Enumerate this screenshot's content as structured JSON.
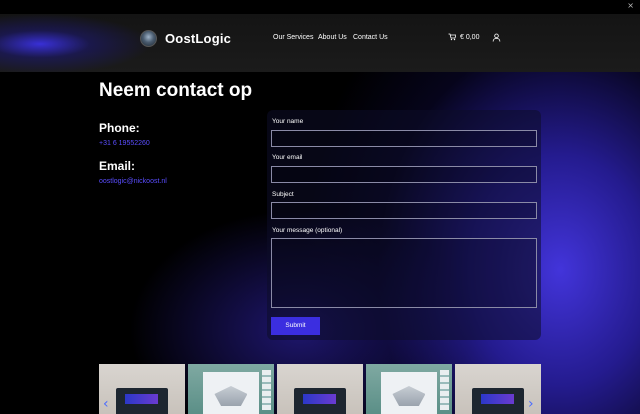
{
  "header": {
    "brand": "OostLogic",
    "nav": [
      "Our Services",
      "About Us",
      "Contact Us"
    ],
    "cart_total": "€ 0,00"
  },
  "main": {
    "title": "Neem contact op",
    "phone_label": "Phone:",
    "phone_value": "+31 6 19552260",
    "email_label": "Email:",
    "email_value": "oostlogic@nickoost.nl"
  },
  "form": {
    "name_label": "Your name",
    "email_label": "Your email",
    "subject_label": "Subject",
    "message_label": "Your message (optional)",
    "submit_label": "Submit"
  },
  "colors": {
    "accent": "#3b2ee0",
    "link": "#5a4dff",
    "background": "#000000"
  },
  "icons": [
    "close-icon",
    "logo-icon",
    "cart-icon",
    "user-icon",
    "chevron-left-icon",
    "chevron-right-icon"
  ]
}
